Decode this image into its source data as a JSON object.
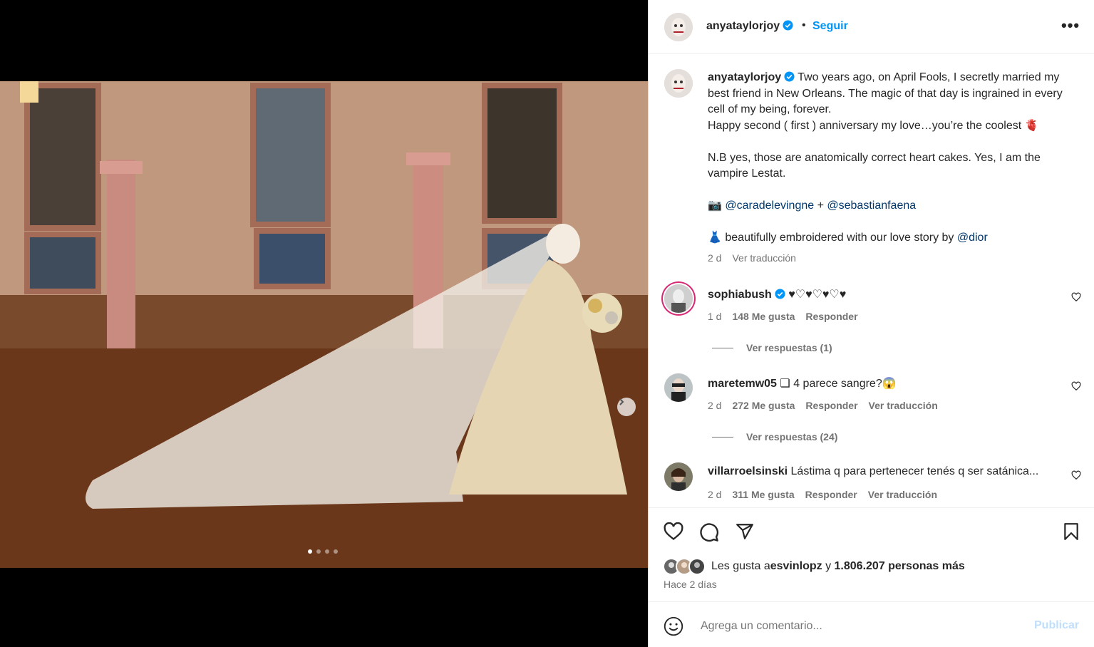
{
  "post": {
    "author": "anyataylorjoy",
    "separator": "•",
    "follow_label": "Seguir",
    "more_label": "•••"
  },
  "media": {
    "slide_count": 4,
    "active_slide": 1
  },
  "caption": {
    "username": "anyataylorjoy",
    "line1": "Two years ago, on April Fools, I secretly married my best friend in New Orleans. The magic of that day is ingrained in every cell of my being, forever.\nHappy second ( first ) anniversary my love…you’re the coolest 🫀\n\nN.B yes, those are anatomically correct heart cakes. Yes, I am the vampire Lestat.\n\n📷 ",
    "mention1": "@caradelevingne",
    "plus": " + ",
    "mention2": "@sebastianfaena",
    "dress_line": "\n\n👗 beautifully embroidered with our love story by ",
    "mention3": "@dior",
    "time": "2 d",
    "translate": "Ver traducción"
  },
  "comments": [
    {
      "username": "sophiabush",
      "text": "♥♡♥♡♥♡♥",
      "time": "1 d",
      "likes": "148 Me gusta",
      "reply": "Responder",
      "translate": "",
      "view_replies": "Ver respuestas (1)"
    },
    {
      "username": "maretemw05",
      "text": "❏ 4 parece sangre?😱",
      "time": "2 d",
      "likes": "272 Me gusta",
      "reply": "Responder",
      "translate": "Ver traducción",
      "view_replies": "Ver respuestas (24)"
    },
    {
      "username": "villarroelsinski",
      "text": "Lástima q para pertenecer tenés q ser satánica...",
      "time": "2 d",
      "likes": "311 Me gusta",
      "reply": "Responder",
      "translate": "Ver traducción",
      "view_replies": ""
    }
  ],
  "likes": {
    "prefix": "Les gusta a ",
    "user": "esvinlopz",
    "middle": " y ",
    "count": "1.806.207 personas más",
    "time_ago": "Hace 2 días"
  },
  "composer": {
    "placeholder": "Agrega un comentario...",
    "publish_label": "Publicar"
  },
  "colors": {
    "accent": "#0095f6",
    "mention": "#00376b",
    "muted": "#737373",
    "publish_disabled": "#c0dffd"
  },
  "icons": [
    "verified-badge-icon",
    "more-options-icon",
    "chevron-right-icon",
    "heart-icon",
    "comment-icon",
    "share-icon",
    "bookmark-icon",
    "emoji-icon"
  ]
}
